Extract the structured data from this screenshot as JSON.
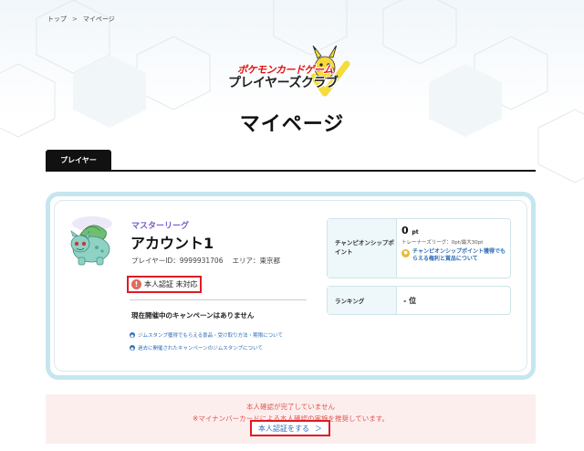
{
  "breadcrumb": {
    "home": "トップ",
    "separator": ">",
    "current": "マイページ"
  },
  "logo": {
    "line1": "ポケモンカードゲーム",
    "line2": "プレイヤーズクラブ"
  },
  "page_title": "マイページ",
  "tabs": [
    {
      "label": "プレイヤー"
    }
  ],
  "profile": {
    "league": "マスターリーグ",
    "account_name": "アカウント1",
    "player_id": "プレイヤーID：9999931706",
    "area": "エリア：東京都",
    "verification_status": "本人認証 未対応",
    "warn_glyph": "!",
    "campaign_note": "現在開催中のキャンペーンはありません",
    "links": [
      {
        "label": "ジムスタンプ獲得でもらえる景品・受け取り方法・期限について"
      },
      {
        "label": "過去に開催されたキャンペーンのジムスタンプについて"
      }
    ]
  },
  "champion_points": {
    "label": "チャンピオンシップポイント",
    "value": "0",
    "unit": "pt",
    "sub": "トレーナーズリーグ：0pt/最大30pt",
    "link": "チャンピオンシップポイント獲得でもらえる権利と賞品について"
  },
  "ranking": {
    "label": "ランキング",
    "value": "- 位"
  },
  "notice": {
    "line1": "本人確認が完了していません",
    "line2": "※マイナンバーカードによる本人確認の実施を推奨しています。",
    "button_label": "本人認証をする",
    "button_arrow": "＞"
  },
  "colors": {
    "accent_red": "#e01b24",
    "link_blue": "#2d6eb8",
    "card_border": "#c6e6ef",
    "league_purple": "#7a5bc9"
  }
}
